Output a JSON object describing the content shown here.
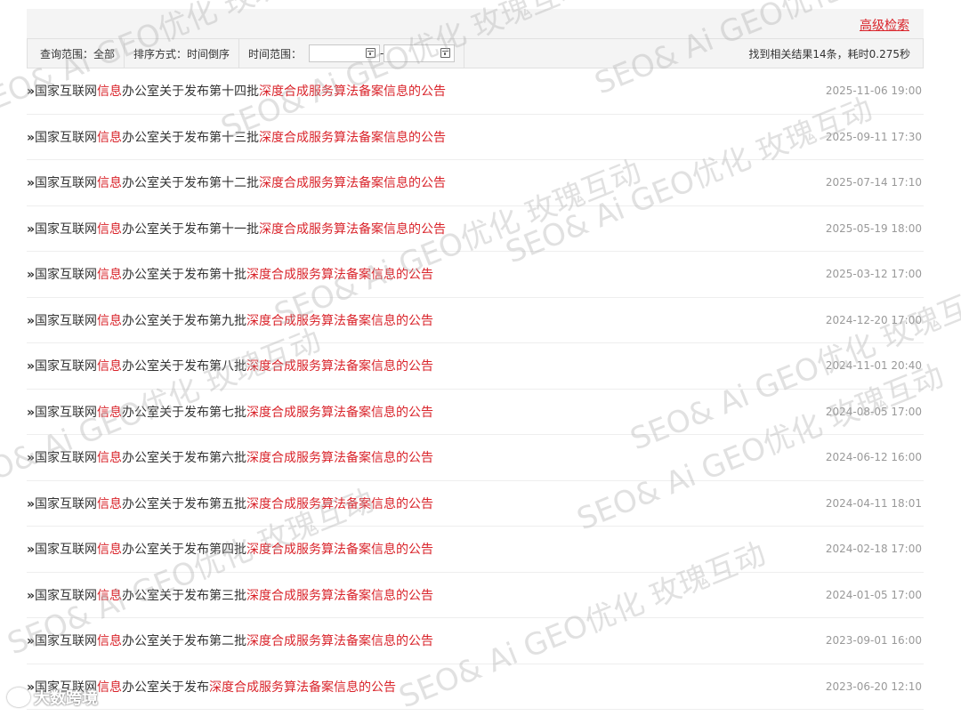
{
  "header": {
    "advanced_search": "高级检索"
  },
  "filter": {
    "scope": "查询范围：全部",
    "sort": "排序方式：时间倒序",
    "time_range_label": "时间范围：",
    "date_separator": "-",
    "result_summary": "找到相关结果14条，耗时0.275秒"
  },
  "items": [
    {
      "prefix": "国家互联网",
      "kw1": "信息",
      "mid": "办公室关于发布第十四批",
      "kw2": "深度合成服务算法备案信息的公告",
      "date": "2025-11-06 19:00"
    },
    {
      "prefix": "国家互联网",
      "kw1": "信息",
      "mid": "办公室关于发布第十三批",
      "kw2": "深度合成服务算法备案信息的公告",
      "date": "2025-09-11 17:30"
    },
    {
      "prefix": "国家互联网",
      "kw1": "信息",
      "mid": "办公室关于发布第十二批",
      "kw2": "深度合成服务算法备案信息的公告",
      "date": "2025-07-14 17:10"
    },
    {
      "prefix": "国家互联网",
      "kw1": "信息",
      "mid": "办公室关于发布第十一批",
      "kw2": "深度合成服务算法备案信息的公告",
      "date": "2025-05-19 18:00"
    },
    {
      "prefix": "国家互联网",
      "kw1": "信息",
      "mid": "办公室关于发布第十批",
      "kw2": "深度合成服务算法备案信息的公告",
      "date": "2025-03-12 17:00"
    },
    {
      "prefix": "国家互联网",
      "kw1": "信息",
      "mid": "办公室关于发布第九批",
      "kw2": "深度合成服务算法备案信息的公告",
      "date": "2024-12-20 17:00"
    },
    {
      "prefix": "国家互联网",
      "kw1": "信息",
      "mid": "办公室关于发布第八批",
      "kw2": "深度合成服务算法备案信息的公告",
      "date": "2024-11-01 20:40"
    },
    {
      "prefix": "国家互联网",
      "kw1": "信息",
      "mid": "办公室关于发布第七批",
      "kw2": "深度合成服务算法备案信息的公告",
      "date": "2024-08-05 17:00"
    },
    {
      "prefix": "国家互联网",
      "kw1": "信息",
      "mid": "办公室关于发布第六批",
      "kw2": "深度合成服务算法备案信息的公告",
      "date": "2024-06-12 16:00"
    },
    {
      "prefix": "国家互联网",
      "kw1": "信息",
      "mid": "办公室关于发布第五批",
      "kw2": "深度合成服务算法备案信息的公告",
      "date": "2024-04-11 18:01"
    },
    {
      "prefix": "国家互联网",
      "kw1": "信息",
      "mid": "办公室关于发布第四批",
      "kw2": "深度合成服务算法备案信息的公告",
      "date": "2024-02-18 17:00"
    },
    {
      "prefix": "国家互联网",
      "kw1": "信息",
      "mid": "办公室关于发布第三批",
      "kw2": "深度合成服务算法备案信息的公告",
      "date": "2024-01-05 17:00"
    },
    {
      "prefix": "国家互联网",
      "kw1": "信息",
      "mid": "办公室关于发布第二批",
      "kw2": "深度合成服务算法备案信息的公告",
      "date": "2023-09-01 16:00"
    },
    {
      "prefix": "国家互联网",
      "kw1": "信息",
      "mid": "办公室关于发布",
      "kw2": "深度合成服务算法备案信息的公告",
      "date": "2023-06-20 12:10"
    }
  ],
  "bullet": "»",
  "watermark_text": "SEO& Ai GEO优化  玫瑰互动",
  "logo_text": "大数跨境",
  "colors": {
    "highlight": "#d9232a",
    "date": "#999999",
    "bar_bg": "#f4f4f4"
  }
}
